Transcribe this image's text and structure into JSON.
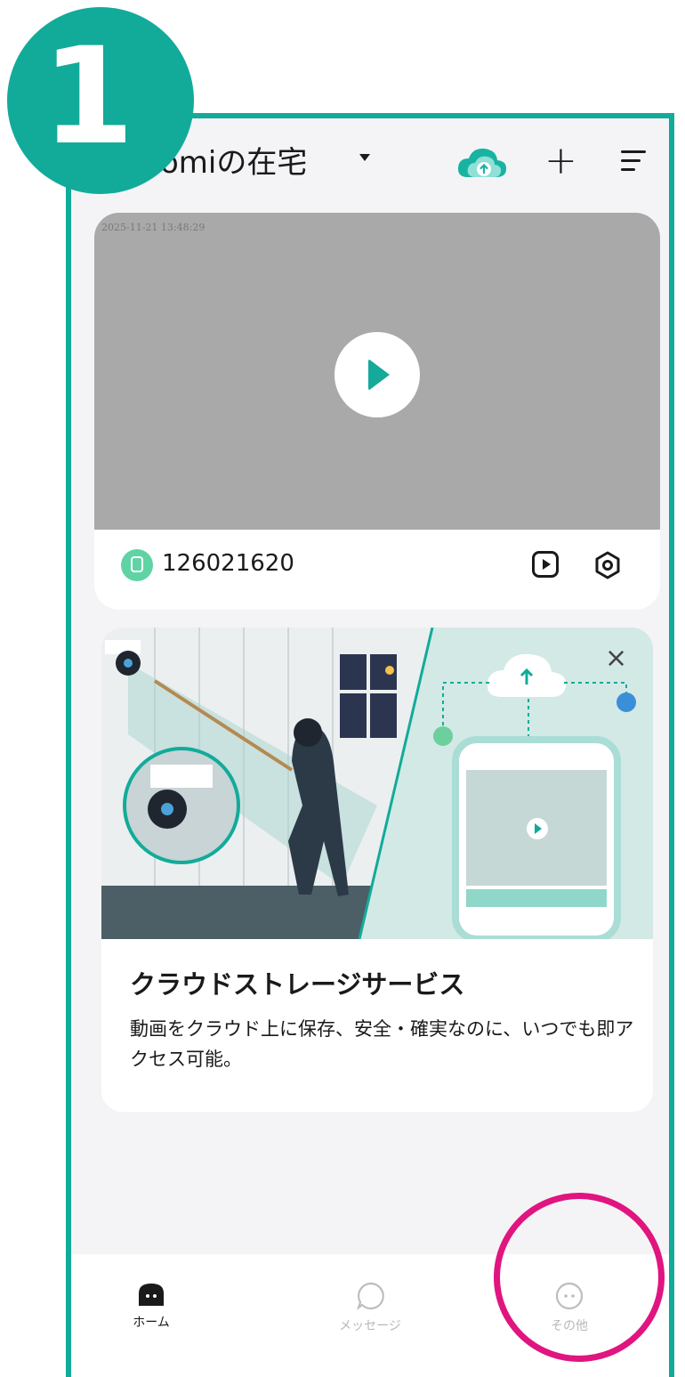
{
  "step_number": "1",
  "header": {
    "home_title": "omiの在宅"
  },
  "camera": {
    "timestamp": "2025-11-21 13:48:29",
    "device_id": "126021620"
  },
  "promo": {
    "title": "クラウドストレージサービス",
    "description": "動画をクラウド上に保存、安全・確実なのに、いつでも即アクセス可能。"
  },
  "tabs": [
    {
      "label": "ホーム",
      "icon": "home-icon",
      "active": true
    },
    {
      "label": "メッセージ",
      "icon": "message-icon",
      "active": false
    },
    {
      "label": "その他",
      "icon": "more-icon",
      "active": false
    }
  ],
  "colors": {
    "accent": "#12ab9a",
    "highlight": "#e0157f"
  }
}
